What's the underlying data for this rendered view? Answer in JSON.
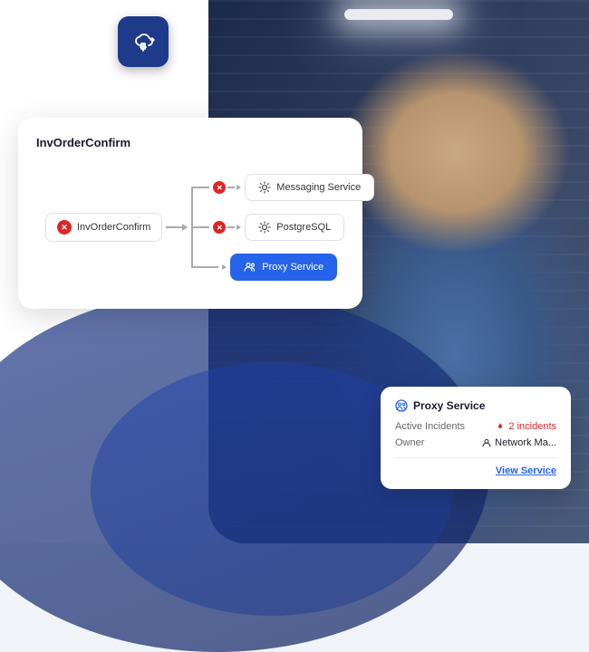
{
  "cloud_icon": {
    "label": "cloud-upload"
  },
  "diagram_card": {
    "title": "InvOrderConfirm",
    "source_node": "InvOrderConfirm",
    "targets": [
      {
        "label": "Messaging Service",
        "type": "service",
        "color": "default"
      },
      {
        "label": "PostgreSQL",
        "type": "database",
        "color": "default"
      },
      {
        "label": "Proxy Service",
        "type": "proxy",
        "color": "blue"
      }
    ]
  },
  "popup": {
    "title": "Proxy Service",
    "rows": [
      {
        "label": "Active Incidents",
        "value": "2 incidents",
        "type": "incidents"
      },
      {
        "label": "Owner",
        "value": "Network Ma...",
        "type": "owner"
      }
    ],
    "link_label": "View Service"
  },
  "colors": {
    "accent_blue": "#2563eb",
    "error_red": "#dc2626",
    "dark_navy": "#1e3a8a",
    "text_dark": "#1a1a2e",
    "text_muted": "#666666",
    "border": "#e0e0e0"
  }
}
